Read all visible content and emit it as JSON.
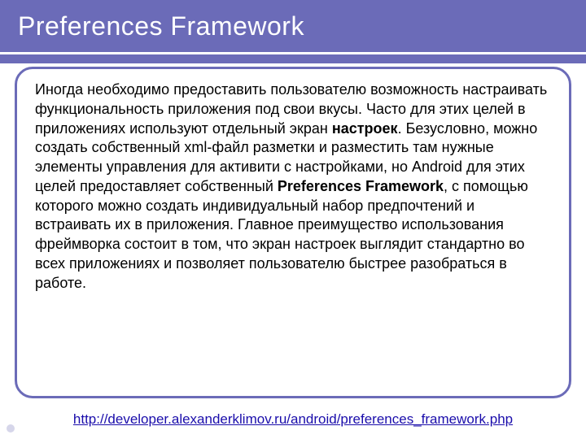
{
  "slide": {
    "title": "Preferences Framework",
    "body_p1": "Иногда необходимо предоставить пользователю возможность настраивать функциональность приложения под свои вкусы. Часто для этих целей в приложениях используют отдельный экран ",
    "body_b1": "настроек",
    "body_p2": ". Безусловно, можно создать собственный xml-файл разметки и разместить там нужные элементы управления для активити с настройками, но Android для этих целей предоставляет собственный ",
    "body_b2": "Preferences Framework",
    "body_p3": ", с помощью которого можно создать индивидуальный набор предпочтений и встраивать их в приложения. Главное преимущество использования фреймворка состоит в том, что экран настроек выглядит стандартно во всех приложениях и позволяет пользователю быстрее разобраться в работе.",
    "link_text": "http://developer.alexanderklimov.ru/android/preferences_framework.php",
    "link_href": "http://developer.alexanderklimov.ru/android/preferences_framework.php"
  }
}
